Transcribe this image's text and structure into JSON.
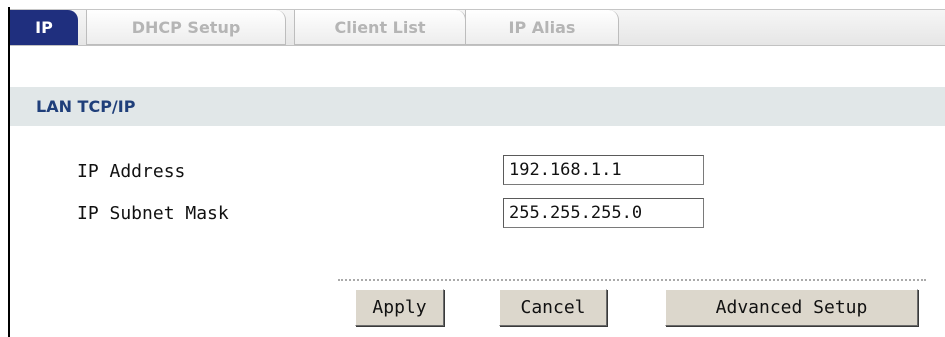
{
  "tabs": [
    {
      "label": "IP",
      "active": true
    },
    {
      "label": "DHCP Setup",
      "active": false
    },
    {
      "label": "Client List",
      "active": false
    },
    {
      "label": "IP Alias",
      "active": false
    }
  ],
  "section": {
    "title": "LAN TCP/IP"
  },
  "fields": {
    "ip_address": {
      "label": "IP Address",
      "value": "192.168.1.1"
    },
    "subnet_mask": {
      "label": "IP Subnet Mask",
      "value": "255.255.255.0"
    }
  },
  "buttons": {
    "apply": "Apply",
    "cancel": "Cancel",
    "advanced": "Advanced Setup"
  },
  "colors": {
    "active_tab": "#1f2f7e",
    "section_header_bg": "#e1e7e8",
    "section_header_text": "#1f3f7a",
    "button_face": "#dcd7cc"
  }
}
